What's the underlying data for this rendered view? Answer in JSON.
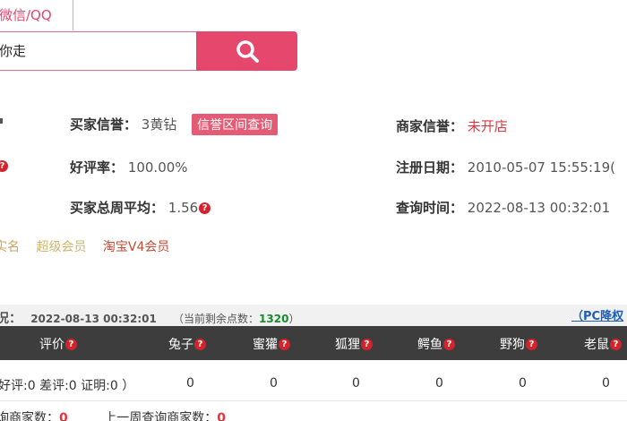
{
  "tab": {
    "label": "微信/QQ"
  },
  "search": {
    "value": "你走",
    "button_icon": "search-icon"
  },
  "info": {
    "buyer_credit_label": "买家信誉：",
    "buyer_credit_value": "3黄钻",
    "credit_query_button": "信誉区间查询",
    "shop_credit_label": "商家信誉：",
    "shop_credit_value": "未开店",
    "good_rate_label": "好评率：",
    "good_rate_value": "100.00%",
    "register_label": "注册日期：",
    "register_value": "2010-05-07 15:55:19(",
    "weekly_avg_label": "买家总周平均：",
    "weekly_avg_value": "1.56",
    "query_time_label": "查询时间：",
    "query_time_value": "2022-08-13 00:32:01"
  },
  "tags": [
    "实名",
    "超级会员",
    "淘宝V4会员"
  ],
  "status_bar": {
    "prefix": "况：",
    "time": "2022-08-13 00:32:01",
    "remaining_label": "（当前剩余点数：",
    "remaining_value": "1320",
    "remaining_suffix": "）",
    "pc_link": "（PC降权"
  },
  "table": {
    "headers": [
      "评价",
      "兔子",
      "蜜獾",
      "狐狸",
      "鳄鱼",
      "野狗",
      "老鼠"
    ],
    "row": [
      "好评:0 差评:0 证明:0 ）",
      "0",
      "0",
      "0",
      "0",
      "0",
      "0"
    ]
  },
  "footer": {
    "label1": "询商家数：",
    "value1": "0",
    "label2": "上一周查询商家数：",
    "value2": "0"
  },
  "colors": {
    "accent": "#e6476c",
    "header_bg": "#3d3d3d",
    "alert": "#e4353f"
  }
}
